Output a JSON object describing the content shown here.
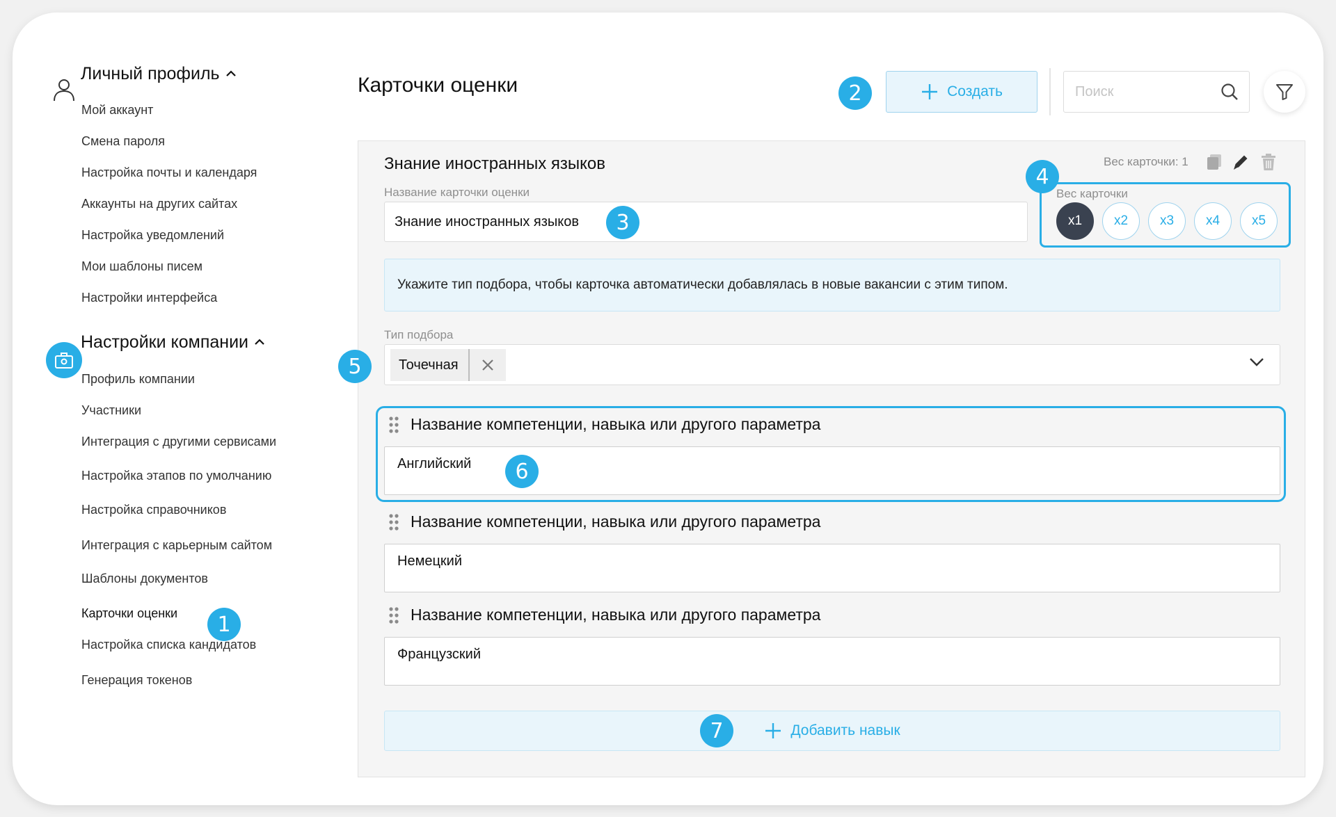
{
  "sidebar": {
    "personal": {
      "title": "Личный профиль",
      "items": [
        "Мой аккаунт",
        "Смена пароля",
        "Настройка почты и календаря",
        "Аккаунты на других сайтах",
        "Настройка уведомлений",
        "Мои шаблоны писем",
        "Настройки интерфейса"
      ]
    },
    "company": {
      "title": "Настройки компании",
      "items": [
        "Профиль компании",
        "Участники",
        "Интеграция с другими сервисами",
        "Настройка этапов по умолчанию",
        "Настройка справочников",
        "Интеграция с карьерным сайтом",
        "Шаблоны документов",
        "Карточки оценки",
        "Настройка списка кандидатов",
        "Генерация токенов"
      ],
      "active_item": "Карточки оценки"
    }
  },
  "header": {
    "title": "Карточки оценки",
    "create_label": "Создать",
    "search_placeholder": "Поиск"
  },
  "card": {
    "title": "Знание иностранных языков",
    "weight_caption": "Вес карточки: 1",
    "name_label": "Название карточки оценки",
    "name_value": "Знание иностранных языков",
    "weight_label": "Вес карточки",
    "weight_options": [
      "x1",
      "x2",
      "x3",
      "x4",
      "x5"
    ],
    "weight_selected": "x1",
    "info_text": "Укажите тип подбора, чтобы карточка автоматически добавлялась в новые вакансии с этим типом.",
    "type_label": "Тип подбора",
    "type_tag": "Точечная",
    "skill_label": "Название компетенции, навыка или другого параметра",
    "skills": [
      "Английский",
      "Немецкий",
      "Французский"
    ],
    "add_skill_label": "Добавить навык"
  },
  "badges": [
    "1",
    "2",
    "3",
    "4",
    "5",
    "6",
    "7"
  ],
  "colors": {
    "accent": "#29aee6",
    "selected_chip": "#3a4250",
    "info_bg": "#e9f5fb"
  },
  "icons": [
    "user-icon",
    "briefcase-icon",
    "chevron-up-icon",
    "plus-icon",
    "search-icon",
    "filter-icon",
    "copy-icon",
    "pencil-icon",
    "trash-icon",
    "close-icon",
    "chevron-down-icon",
    "drag-handle-icon"
  ]
}
